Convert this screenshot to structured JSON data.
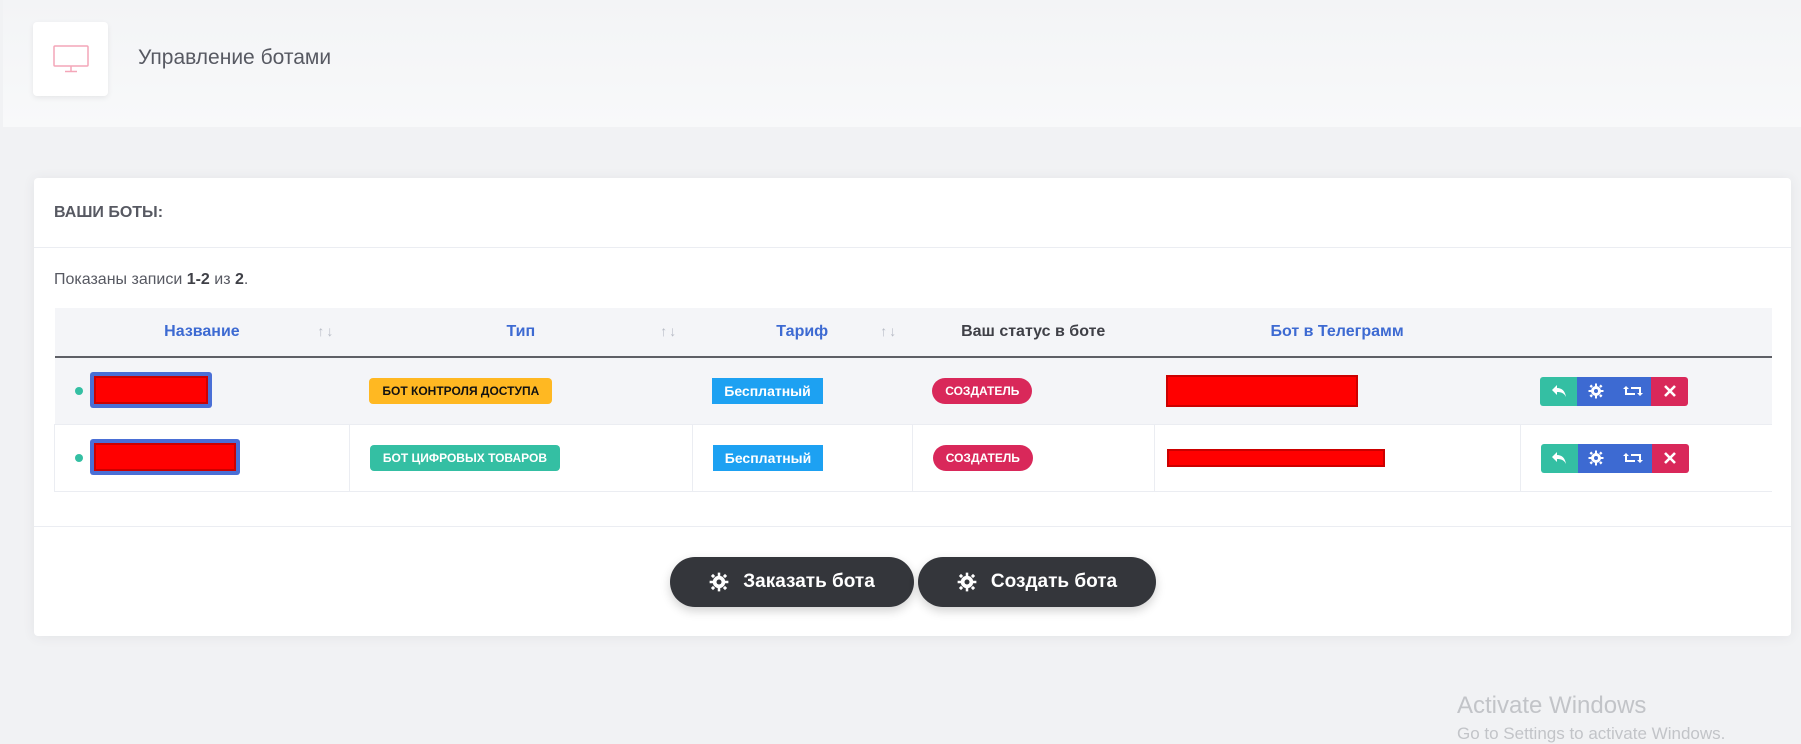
{
  "header": {
    "icon": "monitor-icon",
    "title": "Управление ботами"
  },
  "card": {
    "title": "ВАШИ БОТЫ:",
    "summary": {
      "prefix": "Показаны записи ",
      "range": "1-2",
      "middle": " из ",
      "total": "2",
      "suffix": "."
    }
  },
  "table": {
    "columns": [
      {
        "label": "Название",
        "sortable": true
      },
      {
        "label": "Тип",
        "sortable": true
      },
      {
        "label": "Тариф",
        "sortable": true
      },
      {
        "label": "Ваш статус в боте",
        "sortable": false
      },
      {
        "label": "Бот в Телеграмм",
        "sortable": false
      },
      {
        "label": "",
        "sortable": false
      }
    ],
    "sort_glyph": "↑↓",
    "rows": [
      {
        "type": "БОТ КОНТРОЛЯ ДОСТУПА",
        "type_color": "#ffb822",
        "plan": "Бесплатный",
        "role": "СОЗДАТЕЛЬ"
      },
      {
        "type": "БОТ ЦИФРОВЫХ ТОВАРОВ",
        "type_color": "#34bfa3",
        "plan": "Бесплатный",
        "role": "СОЗДАТЕЛЬ"
      }
    ],
    "row_actions": [
      "reply-icon",
      "gear-icon",
      "retweet-icon",
      "close-icon"
    ]
  },
  "footer": {
    "order_button": "Заказать бота",
    "create_button": "Создать бота"
  },
  "watermark": {
    "title": "Activate Windows",
    "subtitle": "Go to Settings to activate Windows."
  },
  "colors": {
    "accent_blue": "#3d6ad2",
    "success": "#34bfa3",
    "warning": "#ffb822",
    "danger": "#d9285a",
    "info": "#1da1f2",
    "dark_button": "#34363b"
  }
}
